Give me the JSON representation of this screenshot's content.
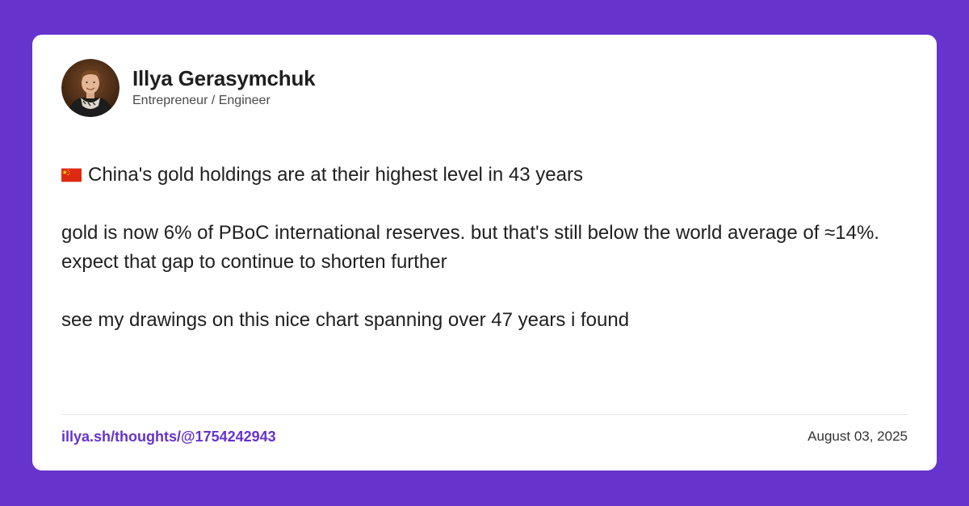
{
  "author": {
    "name": "Illya Gerasymchuk",
    "role": "Entrepreneur / Engineer",
    "avatar_icon": "profile-photo"
  },
  "post": {
    "flag_icon": "china-flag-icon",
    "line1": "China's gold holdings are at their highest level in 43 years",
    "line2": "gold is now 6% of PBoC international reserves. but that's still below the world average of ≈14%. expect that gap to continue to shorten further",
    "line3": "see my drawings on this nice chart spanning over 47 years i found"
  },
  "footer": {
    "link": "illya.sh/thoughts/@1754242943",
    "date": "August 03, 2025"
  },
  "colors": {
    "background": "#6633cc",
    "card": "#ffffff",
    "link": "#6633cc",
    "flag_red": "#de2910",
    "flag_yellow": "#ffde00"
  }
}
